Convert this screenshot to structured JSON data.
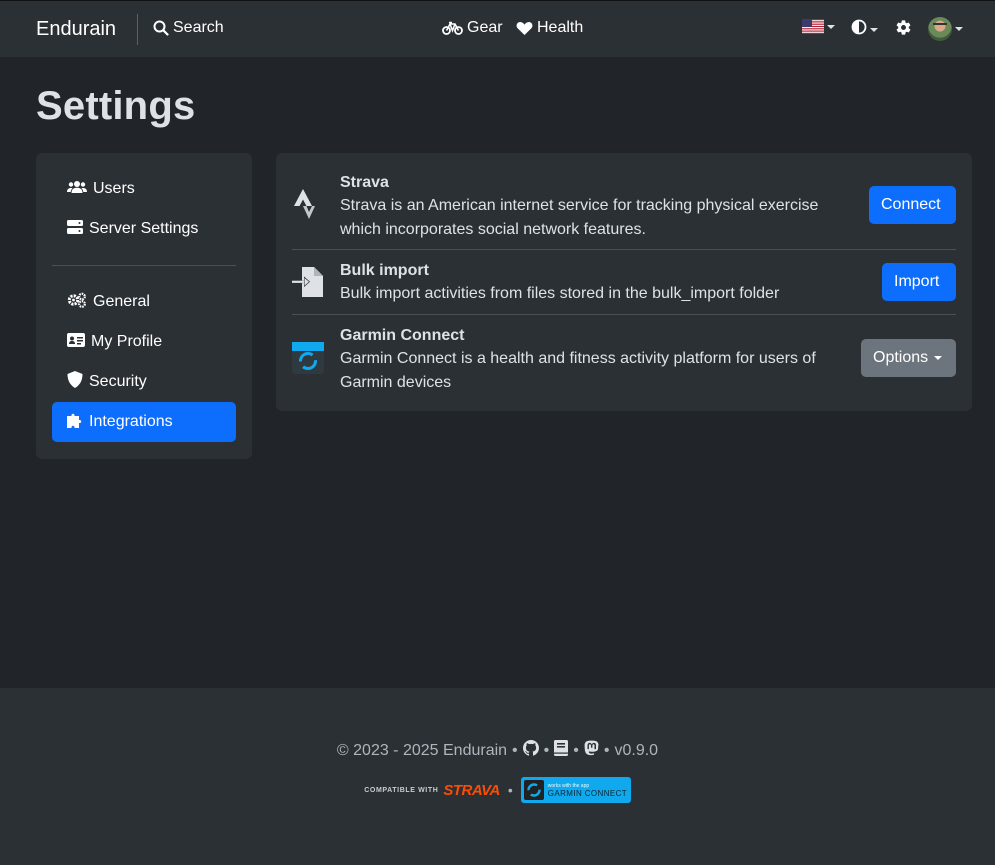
{
  "navbar": {
    "brand": "Endurain",
    "search": "Search",
    "gear": "Gear",
    "health": "Health"
  },
  "page": {
    "title": "Settings"
  },
  "sidebar": {
    "items": [
      {
        "label": "Users",
        "icon": "users-icon"
      },
      {
        "label": "Server Settings",
        "icon": "server-icon"
      },
      {
        "label": "General",
        "icon": "gears-icon"
      },
      {
        "label": "My Profile",
        "icon": "id-card-icon"
      },
      {
        "label": "Security",
        "icon": "shield-icon"
      },
      {
        "label": "Integrations",
        "icon": "puzzle-icon",
        "active": true
      }
    ]
  },
  "integrations": [
    {
      "title": "Strava",
      "description": "Strava is an American internet service for tracking physical exercise which incorporates social network features.",
      "button": "Connect"
    },
    {
      "title": "Bulk import",
      "description": "Bulk import activities from files stored in the bulk_import folder",
      "button": "Import"
    },
    {
      "title": "Garmin Connect",
      "description": "Garmin Connect is a health and fitness activity platform for users of Garmin devices",
      "button": "Options"
    }
  ],
  "footer": {
    "copyright": "© 2023 - 2025 Endurain",
    "bullet": "•",
    "version": "v0.9.0",
    "strava_compatible": "COMPATIBLE WITH",
    "strava_logo": "STRAVA",
    "garmin_small": "works with the app",
    "garmin_big": "GARMIN CONNECT"
  },
  "colors": {
    "accent": "#0d6efd",
    "background": "#212529",
    "panel": "#2b3035",
    "strava": "#fc4c02",
    "garmin": "#11a9ed"
  }
}
